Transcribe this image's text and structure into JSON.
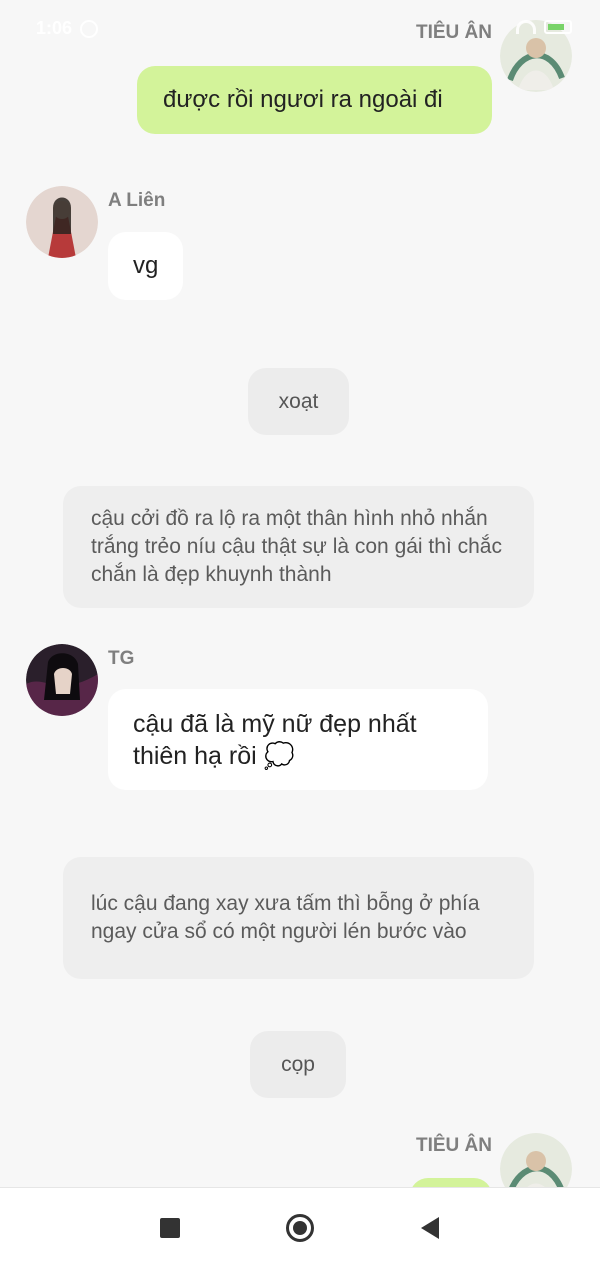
{
  "status_bar": {
    "time": "1:06"
  },
  "messages": [
    {
      "type": "outgoing",
      "sender": "TIÊU ÂN",
      "text": "được rồi ngươi ra ngoài đi"
    },
    {
      "type": "incoming",
      "sender": "A Liên",
      "text": "vg"
    },
    {
      "type": "sfx",
      "text": "xoạt"
    },
    {
      "type": "narration",
      "text": "cậu cởi đồ ra lộ ra một thân hình nhỏ nhắn trắng trẻo níu cậu thật sự là con gái thì chắc chắn là đẹp khuynh thành"
    },
    {
      "type": "incoming",
      "sender": "TG",
      "text": "cậu đã là mỹ nữ đẹp nhất thiên hạ rồi 💭"
    },
    {
      "type": "narration",
      "text": "lúc cậu đang xay xưa tấm thì bỗng ở phía ngay cửa sổ có một người lén bước vào"
    },
    {
      "type": "sfx",
      "text": "cọp"
    },
    {
      "type": "outgoing",
      "sender": "TIÊU ÂN",
      "text": ""
    }
  ],
  "colors": {
    "outgoing_bubble": "#d3f39a",
    "incoming_bubble": "#ffffff",
    "sfx_bubble": "#ececec",
    "background": "#f7f7f7"
  },
  "icons": {
    "alarm": "alarm-icon",
    "wifi": "wifi-icon",
    "battery": "battery-icon",
    "nav_recents": "square-icon",
    "nav_home": "circle-icon",
    "nav_back": "triangle-back-icon"
  }
}
